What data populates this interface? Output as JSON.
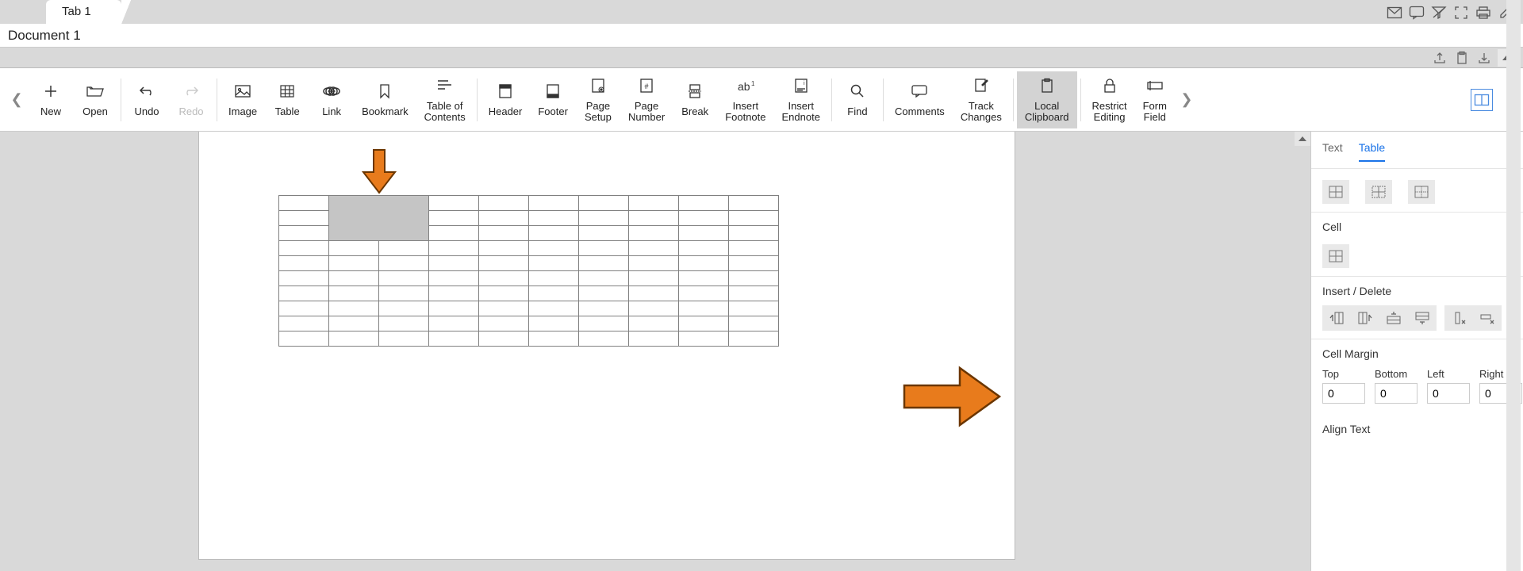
{
  "tab": {
    "label": "Tab 1"
  },
  "document": {
    "title": "Document 1"
  },
  "ribbon": {
    "new": "New",
    "open": "Open",
    "undo": "Undo",
    "redo": "Redo",
    "image": "Image",
    "table": "Table",
    "link": "Link",
    "bookmark": "Bookmark",
    "toc": "Table of\nContents",
    "header": "Header",
    "footer": "Footer",
    "page_setup": "Page\nSetup",
    "page_number": "Page\nNumber",
    "break": "Break",
    "insert_footnote": "Insert\nFootnote",
    "insert_endnote": "Insert\nEndnote",
    "find": "Find",
    "comments": "Comments",
    "track_changes": "Track\nChanges",
    "local_clipboard": "Local\nClipboard",
    "restrict_editing": "Restrict\nEditing",
    "form_field": "Form\nField"
  },
  "sidepanel": {
    "tab_text": "Text",
    "tab_table": "Table",
    "cell_label": "Cell",
    "insdel_label": "Insert / Delete",
    "cellmargin_label": "Cell Margin",
    "aligntext_label": "Align Text",
    "margins": {
      "top_label": "Top",
      "top_value": "0",
      "bottom_label": "Bottom",
      "bottom_value": "0",
      "left_label": "Left",
      "left_value": "0",
      "right_label": "Right",
      "right_value": "0"
    }
  },
  "table_structure": {
    "rows": 10,
    "cols": 10,
    "selection": {
      "row_span": [
        0,
        2
      ],
      "col_span": [
        1,
        2
      ]
    }
  }
}
